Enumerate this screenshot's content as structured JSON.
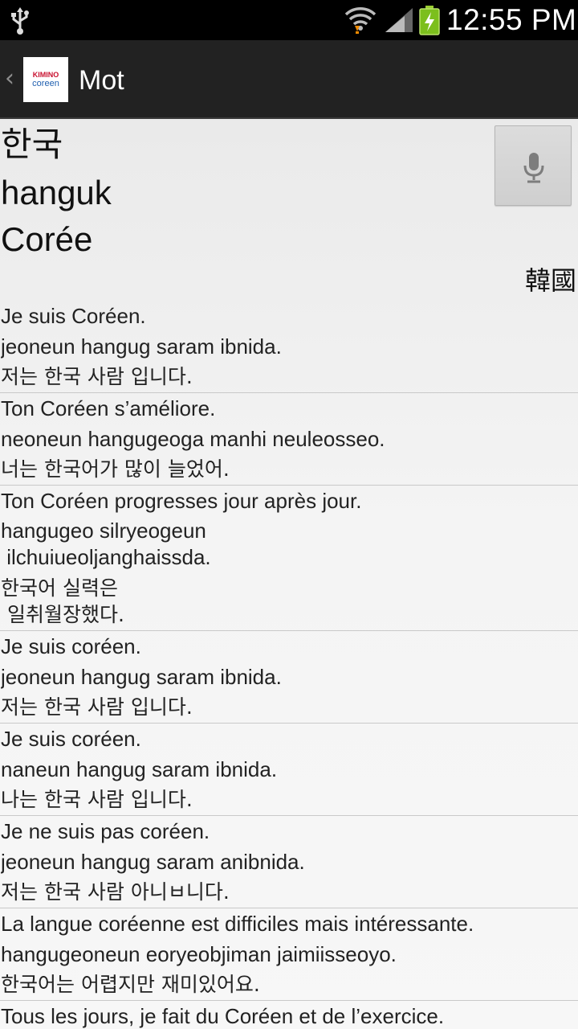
{
  "status_bar": {
    "time": "12:55 PM",
    "icons": [
      "usb-icon",
      "wifi-icon",
      "signal-icon",
      "battery-charging-icon"
    ]
  },
  "action_bar": {
    "logo_top": "KIMINO",
    "logo_bottom": "coreen",
    "title": "Mot"
  },
  "word": {
    "korean": "한국",
    "romanization": "hanguk",
    "french": "Corée",
    "hanja": "韓國"
  },
  "examples": [
    {
      "french": "Je suis Coréen.",
      "roman": "jeoneun hangug saram ibnida.",
      "korean": "저는 한국 사람 입니다."
    },
    {
      "french": "Ton Coréen s’améliore.",
      "roman": "neoneun hangugeoga manhi neuleosseo.",
      "korean": "너는 한국어가 많이 늘었어."
    },
    {
      "french": "Ton Coréen progresses jour après jour.",
      "roman": "hangugeo silryeogeun\n ilchuiueoljanghaissda.",
      "korean": "한국어 실력은\n 일취월장했다."
    },
    {
      "french": "Je suis coréen.",
      "roman": "jeoneun hangug saram ibnida.",
      "korean": "저는 한국 사람 입니다."
    },
    {
      "french": "Je suis coréen.",
      "roman": "naneun hangug saram ibnida.",
      "korean": "나는 한국 사람 입니다."
    },
    {
      "french": "Je ne suis pas coréen.",
      "roman": "jeoneun hangug saram anibnida.",
      "korean": "저는 한국 사람 아니ㅂ니다."
    },
    {
      "french": "La langue coréenne est difficiles mais intéressante.",
      "roman": "hangugeoneun eoryeobjiman jaimiisseoyo.",
      "korean": "한국어는 어렵지만 재미있어요."
    },
    {
      "french": "Tous les jours, je fait du Coréen et de l’exercice.",
      "roman": "",
      "korean": ""
    }
  ]
}
